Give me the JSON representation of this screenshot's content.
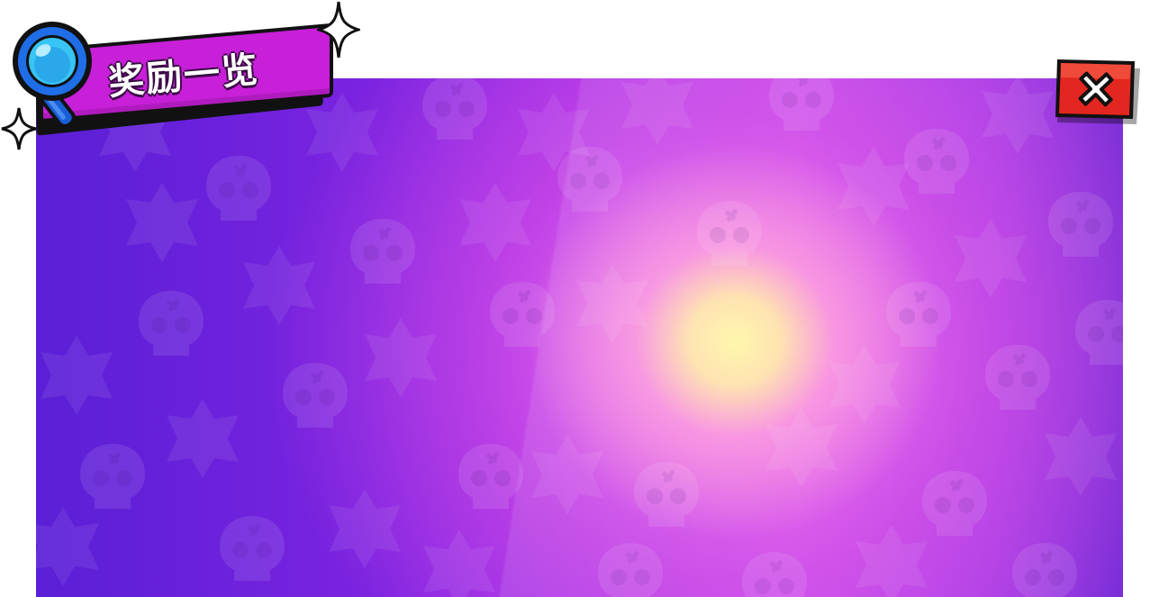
{
  "title": {
    "text": "奖励一览",
    "icon": "magnifier-icon"
  },
  "close_button": {
    "icon": "close-icon"
  },
  "colors": {
    "banner": "#c81fd9",
    "panel_left": "#5a1fd6",
    "panel_right": "#c046ec",
    "glow": "#fff6a8",
    "close_button": "#e3261f"
  }
}
